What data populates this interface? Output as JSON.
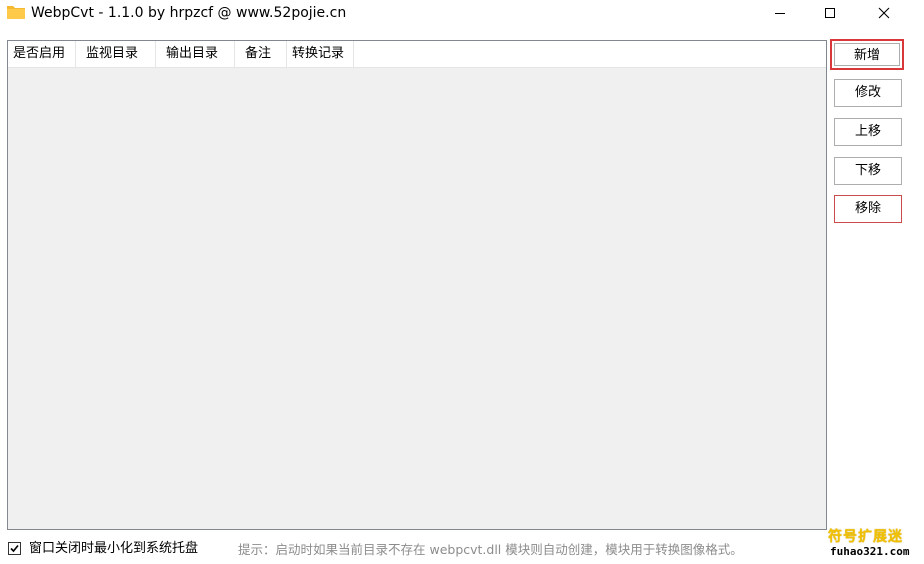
{
  "window": {
    "title": "WebpCvt - 1.1.0 by hrpzcf @ www.52pojie.cn",
    "icon": "folder-icon",
    "controls": [
      "minimize-icon",
      "maximize-icon",
      "close-icon"
    ]
  },
  "list": {
    "columns": [
      "是否启用",
      "监视目录",
      "输出目录",
      "备注",
      "转换记录"
    ],
    "rows": []
  },
  "buttons": {
    "add": "新增",
    "edit": "修改",
    "move_up": "上移",
    "move_down": "下移",
    "remove": "移除"
  },
  "footer": {
    "tray_checkbox_label": "窗口关闭时最小化到系统托盘",
    "tray_checkbox_checked": true,
    "hint": "提示：启动时如果当前目录不存在 webpcvt.dll 模块则自动创建，模块用于转换图像格式。"
  },
  "watermark": {
    "line1": "符号扩展迷",
    "line2": "fuhao321.com"
  },
  "colors": {
    "highlight_border": "#d9383a",
    "list_background": "#f0f0f0",
    "hint_text": "#8c8c8c",
    "watermark_yellow": "#f2c100"
  }
}
